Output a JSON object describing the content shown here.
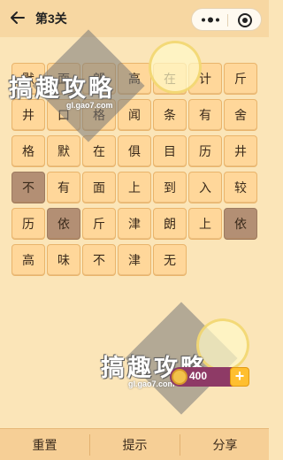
{
  "header": {
    "title": "第3关",
    "back_icon": "arrow-left-icon",
    "more_icon": "more-dots-icon",
    "close_icon": "record-circle-icon"
  },
  "grid": {
    "rows": [
      [
        "默",
        "面",
        "朗",
        "高",
        "在",
        "计",
        "斤"
      ],
      [
        "井",
        "口",
        "格",
        "闻",
        "条",
        "有",
        "舍"
      ],
      [
        "格",
        "默",
        "在",
        "俱",
        "目",
        "历",
        "井"
      ],
      [
        "不",
        "有",
        "面",
        "上",
        "到",
        "入",
        "较"
      ],
      [
        "历",
        "依",
        "斤",
        "津",
        "朗",
        "上",
        "依"
      ],
      [
        "高",
        "味",
        "不",
        "津",
        "无"
      ]
    ],
    "highlighted": [
      [
        3,
        0
      ],
      [
        4,
        1
      ],
      [
        4,
        6
      ]
    ]
  },
  "watermark": {
    "text": "搞趣攻略",
    "url": "gl.gao7.com"
  },
  "coins": {
    "value": "400",
    "icon": "coin-icon",
    "plus_label": "+"
  },
  "bottom_bar": {
    "reset_label": "重置",
    "hint_label": "提示",
    "share_label": "分享"
  },
  "colors": {
    "background": "#fbe5b8",
    "tile": "#ffd79a",
    "tile_highlighted": "#b38f74",
    "header": "#f7d7a2",
    "coin_badge": "#8e3a66"
  }
}
